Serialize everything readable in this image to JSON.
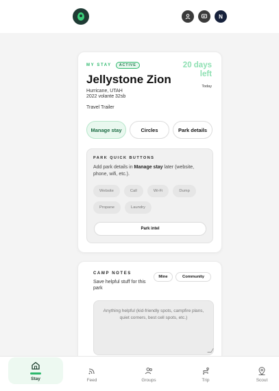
{
  "header": {
    "avatar_initial": "N"
  },
  "stay": {
    "section_label": "MY STAY",
    "status_badge": "ACTIVE",
    "days_left": "20 days left",
    "today": "Today",
    "park_name": "Jellystone Zion",
    "location_line1": "Hurricane, UTAH",
    "location_line2": "2022 volante 32sb",
    "vehicle": "Travel Trailer",
    "tabs": [
      "Manage stay",
      "Circles",
      "Park details"
    ],
    "quick": {
      "title": "PARK QUICK BUTTONS",
      "desc_prefix": "Add park details in ",
      "desc_bold": "Manage stay",
      "desc_suffix": " later (website, phone, wifi, etc.).",
      "chips": [
        "Website",
        "Call",
        "Wi-Fi",
        "Dump",
        "Propane",
        "Laundry"
      ],
      "park_intel": "Park intel"
    }
  },
  "notes": {
    "title": "CAMP NOTES",
    "desc": "Save helpful stuff for this park",
    "segments": [
      "Mine",
      "Community"
    ],
    "placeholder": "Anything helpful (kid-friendly spots, campfire plans, quiet corners, best cell spots, etc.)"
  },
  "nav": {
    "items": [
      "Stay",
      "Feed",
      "Groups",
      "Trip",
      "Scout"
    ]
  },
  "colors": {
    "accent": "#2cb86c",
    "days_left": "#8fe0b3",
    "logo_bg": "#1f3b34"
  }
}
